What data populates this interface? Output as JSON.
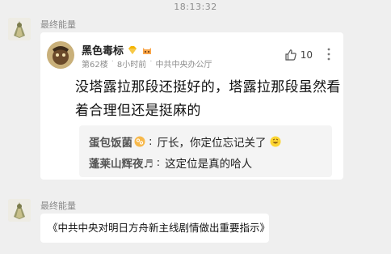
{
  "chat": {
    "timestamp": "18:13:32",
    "messages": [
      {
        "sender": "最终能量",
        "card": {
          "author_name": "黑色毒标",
          "floor": "第62楼",
          "time_ago": "8小时前",
          "location": "中共中央办公厅",
          "separator": "·",
          "likes": "10",
          "text": "没塔露拉那段还挺好的，塔露拉那段虽然看着合理但还是挺麻的",
          "replies": [
            {
              "user": "蛋包饭菌",
              "separator": ":",
              "text": "厅长，你定位忘记关了"
            },
            {
              "user": "蓬莱山辉夜♬",
              "separator": ":",
              "text": "这定位是真的哈人"
            }
          ]
        }
      },
      {
        "sender": "最终能量",
        "text": "《中共中央对明日方舟新主线剧情做出重要指示》"
      }
    ]
  },
  "icons": {
    "like": "thumb-up-icon",
    "more": "more-vertical-icon",
    "badge_gem": "gem-badge-icon",
    "badge_cat": "cat-badge-icon",
    "cancer_emoji": "cancer-zodiac-icon",
    "grin_emoji": "grin-emoji-icon"
  },
  "colors": {
    "background": "#efefef",
    "card": "#ffffff",
    "reply_box": "#f4f4f4",
    "badge_gold": "#f4b400"
  }
}
